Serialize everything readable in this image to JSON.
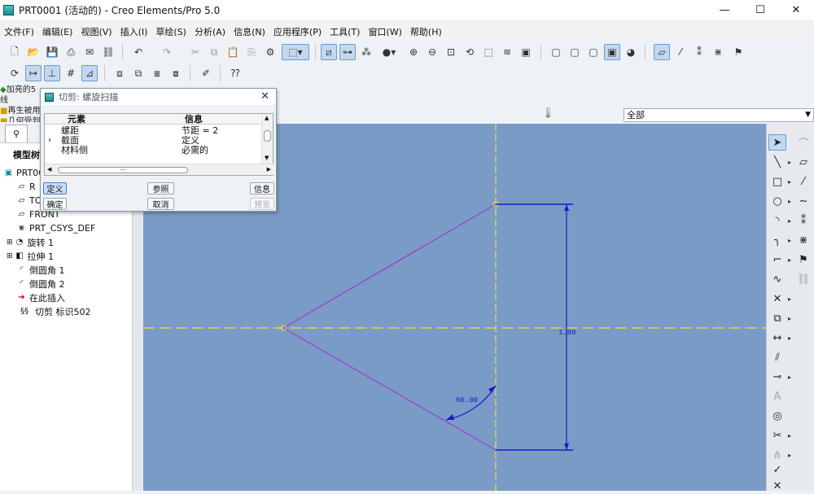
{
  "window": {
    "title": "PRT0001 (活动的) - Creo Elements/Pro 5.0",
    "minimize": "—",
    "maximize": "☐",
    "close": "✕"
  },
  "menu": [
    "文件(F)",
    "编辑(E)",
    "视图(V)",
    "插入(I)",
    "草绘(S)",
    "分析(A)",
    "信息(N)",
    "应用程序(P)",
    "工具(T)",
    "窗口(W)",
    "帮助(H)"
  ],
  "messages": [
    "加亮的5线",
    "再生被用",
    "几何受到"
  ],
  "filter": {
    "value": "全部"
  },
  "model_tree": {
    "title": "模型树",
    "items": [
      {
        "label": "PRT000",
        "icon": "part-icon"
      },
      {
        "label": "R",
        "icon": "datum-plane-icon"
      },
      {
        "label": "TO",
        "icon": "datum-plane-icon"
      },
      {
        "label": "FRONT",
        "icon": "datum-plane-icon"
      },
      {
        "label": "PRT_CSYS_DEF",
        "icon": "csys-icon"
      },
      {
        "label": "旋转 1",
        "icon": "revolve-icon"
      },
      {
        "label": "拉伸 1",
        "icon": "extrude-icon"
      },
      {
        "label": "倒圆角 1",
        "icon": "round-icon"
      },
      {
        "label": "倒圆角 2",
        "icon": "round-icon"
      },
      {
        "label": "在此插入",
        "icon": "insert-arrow-icon"
      },
      {
        "label": "切剪 标识502",
        "icon": "helical-cut-icon"
      }
    ]
  },
  "dialog": {
    "title": "切剪: 螺旋扫描",
    "col_element": "元素",
    "col_info": "信息",
    "rows": [
      {
        "element": "螺距",
        "info": "节距 = 2"
      },
      {
        "element": "截面",
        "info": "定义"
      },
      {
        "element": "材料侧",
        "info": "必需的"
      }
    ],
    "scroll_dots": "···",
    "buttons": {
      "define": "定义",
      "reference": "参照",
      "info": "信息",
      "ok": "确定",
      "cancel": "取消",
      "preview": "预览"
    }
  },
  "sketch": {
    "dim_vertical": "1.80",
    "dim_angle": "60.00",
    "colors": {
      "background": "#7a9bc6",
      "profile": "#a22bd0",
      "dimension": "#1a1ac8",
      "centerline": "#f0e040"
    }
  }
}
